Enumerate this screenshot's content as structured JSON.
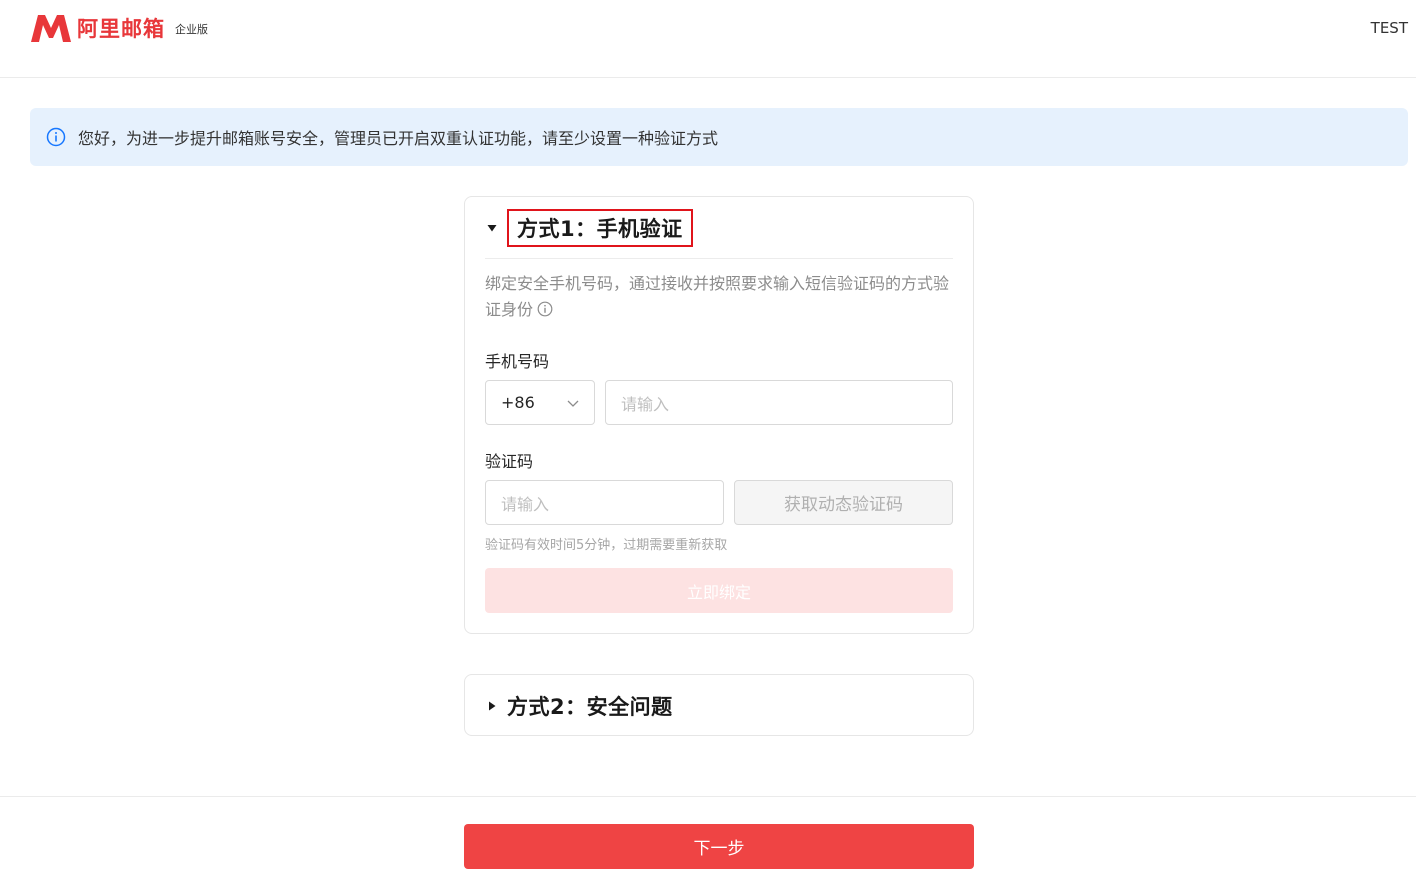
{
  "header": {
    "logo_text": "阿里邮箱",
    "edition": "企业版",
    "user": "TEST"
  },
  "notice": {
    "text": "您好，为进一步提升邮箱账号安全，管理员已开启双重认证功能，请至少设置一种验证方式"
  },
  "method1": {
    "title": "方式1：手机验证",
    "expanded": true,
    "description": "绑定安全手机号码，通过接收并按照要求输入短信验证码的方式验证身份",
    "phone_label": "手机号码",
    "country_code": "+86",
    "phone_placeholder": "请输入",
    "code_label": "验证码",
    "code_placeholder": "请输入",
    "get_code_button": "获取动态验证码",
    "code_hint": "验证码有效时间5分钟，过期需要重新获取",
    "bind_button": "立即绑定"
  },
  "method2": {
    "title": "方式2：安全问题",
    "expanded": false
  },
  "footer": {
    "next_button": "下一步"
  },
  "colors": {
    "brand_red": "#e8373a",
    "primary_button": "#ef4444",
    "disabled_button": "#fde2e2",
    "notice_bg": "#e6f1fd",
    "info_blue": "#1677ff",
    "highlight_box": "#e0141b"
  },
  "icons": {
    "logo": "mail-m-logo-icon",
    "notice": "info-circle-icon",
    "desc": "info-circle-icon",
    "expanded": "caret-down-icon",
    "collapsed": "caret-right-icon",
    "select": "chevron-down-icon"
  }
}
